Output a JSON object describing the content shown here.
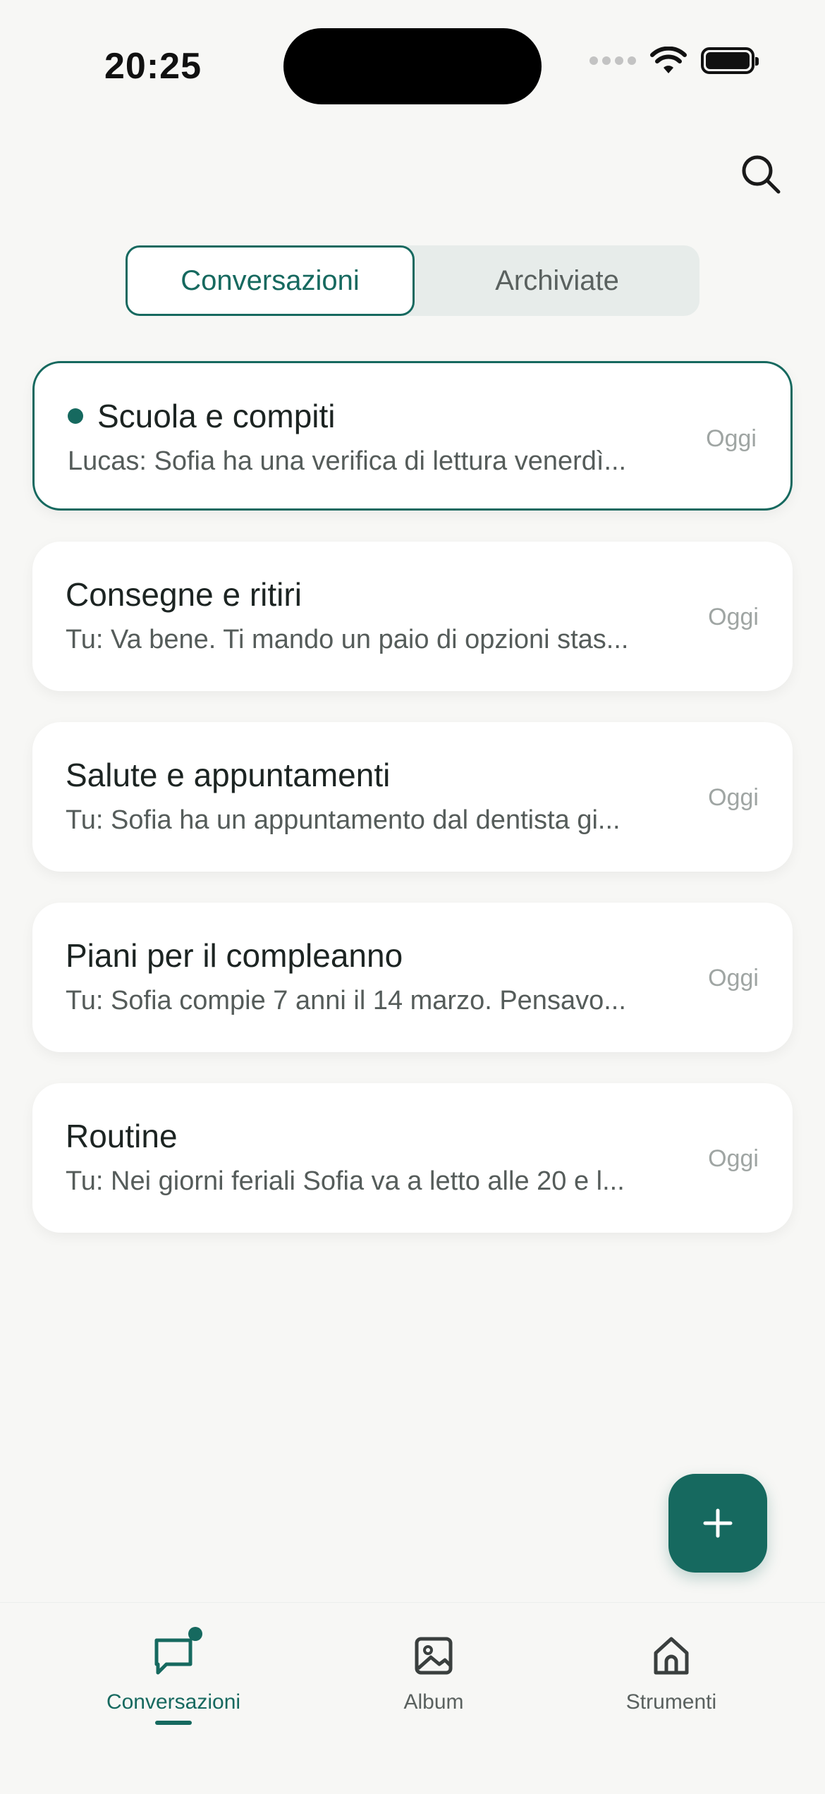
{
  "status_bar": {
    "time": "20:25"
  },
  "tabs": [
    {
      "label": "Conversazioni",
      "active": true
    },
    {
      "label": "Archiviate",
      "active": false
    }
  ],
  "conversations": [
    {
      "title": "Scuola e compiti",
      "preview": "Lucas: Sofia ha una verifica di lettura venerdì...",
      "time": "Oggi",
      "unread": true
    },
    {
      "title": "Consegne e ritiri",
      "preview": "Tu: Va bene. Ti mando un paio di opzioni stas...",
      "time": "Oggi",
      "unread": false
    },
    {
      "title": "Salute e appuntamenti",
      "preview": "Tu: Sofia ha un appuntamento dal dentista gi...",
      "time": "Oggi",
      "unread": false
    },
    {
      "title": "Piani per il compleanno",
      "preview": "Tu: Sofia compie 7 anni il 14 marzo. Pensavo...",
      "time": "Oggi",
      "unread": false
    },
    {
      "title": "Routine",
      "preview": "Tu: Nei giorni feriali Sofia va a letto alle 20 e l...",
      "time": "Oggi",
      "unread": false
    }
  ],
  "bottom_nav": [
    {
      "label": "Conversazioni",
      "icon": "chat-bubble-icon",
      "active": true,
      "badge": true
    },
    {
      "label": "Album",
      "icon": "image-icon",
      "active": false
    },
    {
      "label": "Strumenti",
      "icon": "home-icon",
      "active": false
    }
  ],
  "colors": {
    "accent": "#16695f",
    "background": "#f7f7f5",
    "card": "#ffffff"
  }
}
